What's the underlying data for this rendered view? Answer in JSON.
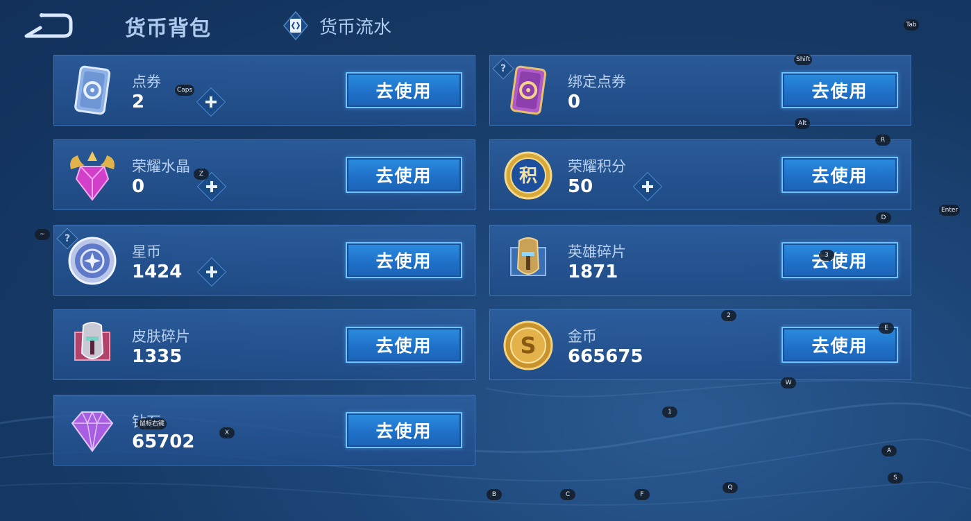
{
  "header": {
    "title": "货币背包",
    "flow_label": "货币流水"
  },
  "use_label": "去使用",
  "cards": [
    {
      "name": "点券",
      "count": "2"
    },
    {
      "name": "绑定点券",
      "count": "0"
    },
    {
      "name": "荣耀水晶",
      "count": "0"
    },
    {
      "name": "荣耀积分",
      "count": "50"
    },
    {
      "name": "星币",
      "count": "1424"
    },
    {
      "name": "英雄碎片",
      "count": "1871"
    },
    {
      "name": "皮肤碎片",
      "count": "1335"
    },
    {
      "name": "金币",
      "count": "665675"
    },
    {
      "name": "钻石",
      "count": "65702"
    }
  ],
  "help_mark": "?",
  "crystal_glyph": "积",
  "gold_glyph": "S",
  "key_hints": {
    "tab": "Tab",
    "shift": "Shift",
    "caps": "Caps",
    "alt": "Alt",
    "r": "R",
    "z": "Z",
    "d": "D",
    "enter": "Enter",
    "tilde": "~",
    "three": "3",
    "two": "2",
    "e": "E",
    "w": "W",
    "one": "1",
    "x": "X",
    "tooltip": "鼠标右键",
    "a": "A",
    "s": "S",
    "q": "Q",
    "b": "B",
    "c": "C",
    "f": "F"
  },
  "colors": {
    "accent": "#2a8de0",
    "card_border": "#3f74b6",
    "label": "#b8d0ee"
  }
}
